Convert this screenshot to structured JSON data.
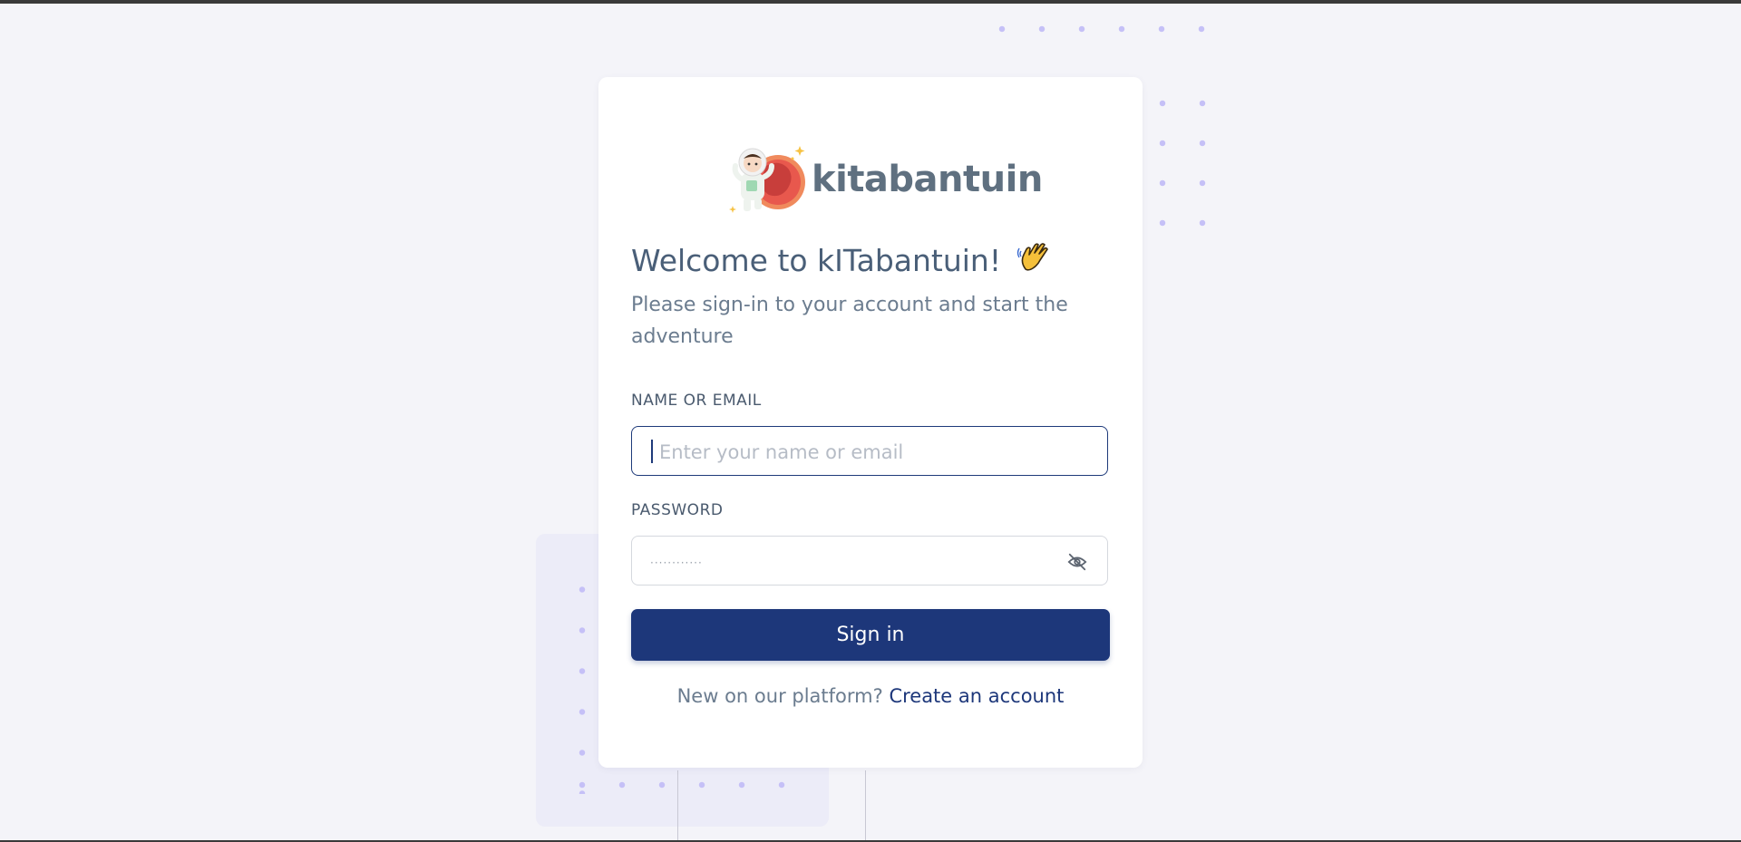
{
  "brand": {
    "name": "kitabantuin",
    "logo_icon": "astronaut-rocket-logo"
  },
  "welcome": {
    "title": "Welcome to kITabantuin!",
    "wave_icon": "waving-hand-emoji",
    "subtitle": "Please sign-in to your account and start the adventure"
  },
  "form": {
    "email_label": "NAME OR EMAIL",
    "email_placeholder": "Enter your name or email",
    "email_value": "",
    "password_label": "PASSWORD",
    "password_mask": "············",
    "password_toggle_icon": "eye-off-icon",
    "submit_label": "Sign in"
  },
  "footer": {
    "prompt": "New on our platform?",
    "link": "Create an account"
  },
  "colors": {
    "primary": "#1d377a",
    "background": "#f4f4f9",
    "text": "#4a5f78",
    "dots": "#c5c0f7"
  }
}
